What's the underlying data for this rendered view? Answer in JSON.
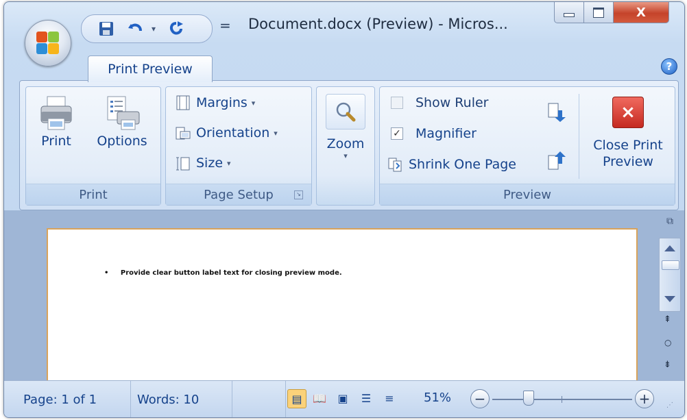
{
  "window": {
    "title": "Document.docx (Preview) - Micros...",
    "controls": {
      "minimize": "minimize-icon",
      "maximize": "maximize-icon",
      "close_label": "X"
    }
  },
  "qat": {
    "icons": [
      "save-icon",
      "undo-icon",
      "undo-dropdown-icon",
      "redo-icon"
    ],
    "customize_label": "="
  },
  "ribbon": {
    "active_tab": "Print Preview",
    "groups": {
      "print": {
        "label": "Print",
        "print_label": "Print",
        "options_label": "Options"
      },
      "page_setup": {
        "label": "Page Setup",
        "margins_label": "Margins",
        "orientation_label": "Orientation",
        "size_label": "Size"
      },
      "zoom": {
        "zoom_label": "Zoom"
      },
      "preview": {
        "label": "Preview",
        "show_ruler_label": "Show Ruler",
        "show_ruler_checked": false,
        "magnifier_label": "Magnifier",
        "magnifier_checked": true,
        "shrink_label": "Shrink One Page",
        "close_label_line1": "Close Print",
        "close_label_line2": "Preview"
      }
    }
  },
  "document": {
    "bullet_text": "Provide clear button label text for closing preview mode."
  },
  "status": {
    "page": "Page: 1 of 1",
    "words": "Words: 10",
    "zoom_percent": "51%",
    "zoom_minus": "−",
    "zoom_plus": "+",
    "zoom_level": 0.51
  },
  "colors": {
    "accent": "#15428b",
    "close_red": "#d9302c",
    "page_border": "#d9a35a"
  }
}
